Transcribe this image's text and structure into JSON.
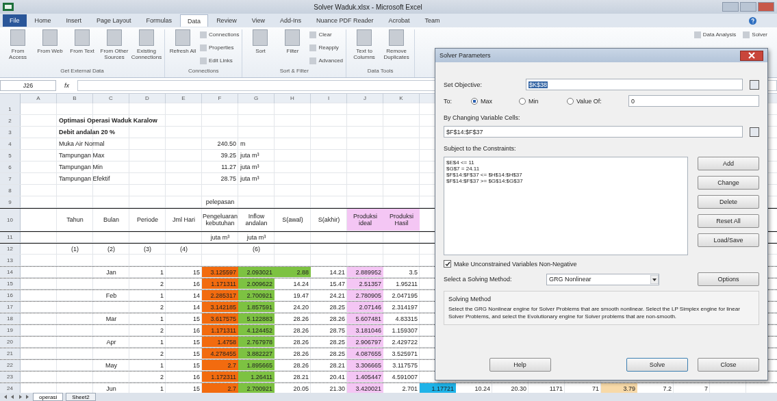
{
  "window": {
    "title": "Solver Waduk.xlsx - Microsoft Excel"
  },
  "tabs": [
    {
      "label": "File",
      "selected": false
    },
    {
      "label": "Home",
      "selected": false
    },
    {
      "label": "Insert",
      "selected": false
    },
    {
      "label": "Page Layout",
      "selected": false
    },
    {
      "label": "Formulas",
      "selected": false
    },
    {
      "label": "Data",
      "selected": true
    },
    {
      "label": "Review",
      "selected": false
    },
    {
      "label": "View",
      "selected": false
    },
    {
      "label": "Add-Ins",
      "selected": false
    },
    {
      "label": "Nuance PDF Reader",
      "selected": false
    },
    {
      "label": "Acrobat",
      "selected": false
    },
    {
      "label": "Team",
      "selected": false
    }
  ],
  "ribbon": {
    "groups": [
      {
        "label": "Get External Data",
        "buttons": [
          {
            "label": "From Access",
            "kind": "large"
          },
          {
            "label": "From Web",
            "kind": "large"
          },
          {
            "label": "From Text",
            "kind": "large"
          },
          {
            "label": "From Other Sources",
            "kind": "large"
          },
          {
            "label": "Existing Connections",
            "kind": "large"
          }
        ]
      },
      {
        "label": "Connections",
        "buttons": [
          {
            "label": "Refresh All",
            "kind": "large"
          },
          {
            "label": "Connections",
            "kind": "small"
          },
          {
            "label": "Properties",
            "kind": "small"
          },
          {
            "label": "Edit Links",
            "kind": "small"
          }
        ]
      },
      {
        "label": "Sort & Filter",
        "buttons": [
          {
            "label": "Sort",
            "kind": "large"
          },
          {
            "label": "Filter",
            "kind": "large"
          },
          {
            "label": "Clear",
            "kind": "small"
          },
          {
            "label": "Reapply",
            "kind": "small"
          },
          {
            "label": "Advanced",
            "kind": "small"
          }
        ]
      },
      {
        "label": "Data Tools",
        "buttons": [
          {
            "label": "Text to Columns",
            "kind": "large"
          },
          {
            "label": "Remove Duplicates",
            "kind": "large"
          }
        ]
      }
    ],
    "right_buttons": [
      "Data Analysis",
      "Solver"
    ]
  },
  "formula_bar": {
    "name_box": "J26",
    "fx": "fx"
  },
  "columns": [
    "A",
    "B",
    "C",
    "D",
    "E",
    "F",
    "G",
    "H",
    "I",
    "J",
    "K"
  ],
  "rows": [
    {
      "num": "1",
      "kind": "blank",
      "cells": {}
    },
    {
      "num": "2",
      "kind": "title",
      "cells": {
        "B": {
          "text": "Optimasi Operasi Waduk Karalow"
        }
      }
    },
    {
      "num": "3",
      "kind": "title",
      "cells": {
        "B": {
          "text": "Debit andalan 20 %"
        }
      }
    },
    {
      "num": "4",
      "kind": "info",
      "cells": {
        "B": {
          "text": "Muka Air Normal"
        },
        "F": {
          "text": "240.50"
        },
        "G": {
          "text": "m"
        }
      }
    },
    {
      "num": "5",
      "kind": "info",
      "cells": {
        "B": {
          "text": "Tampungan Max"
        },
        "F": {
          "text": "39.25"
        },
        "G": {
          "text": "juta m³"
        }
      }
    },
    {
      "num": "6",
      "kind": "info",
      "cells": {
        "B": {
          "text": "Tampungan Min"
        },
        "F": {
          "text": "11.27"
        },
        "G": {
          "text": "juta m³"
        }
      }
    },
    {
      "num": "7",
      "kind": "info",
      "cells": {
        "B": {
          "text": "Tampungan Efektif"
        },
        "F": {
          "text": "28.75"
        },
        "G": {
          "text": "juta m³"
        }
      }
    },
    {
      "num": "8",
      "kind": "blank",
      "cells": {}
    },
    {
      "num": "9",
      "kind": "group",
      "cells": {
        "F": {
          "text": "pelepasan"
        }
      }
    },
    {
      "num": "10",
      "kind": "header",
      "cells": {
        "B": {
          "text": "Tahun"
        },
        "C": {
          "text": "Bulan"
        },
        "D": {
          "text": "Periode"
        },
        "E": {
          "text": "Jml Hari"
        },
        "F": {
          "text": "Pengeluaran kebutuhan"
        },
        "G": {
          "text": "Inflow andalan"
        },
        "H": {
          "text": "S(awal)"
        },
        "I": {
          "text": "S(akhir)"
        },
        "J": {
          "text": "Produksi ideal",
          "color": "#f4c6f4"
        },
        "K": {
          "text": "Produksi Hasil",
          "color": "#f4c6f4"
        }
      }
    },
    {
      "num": "11",
      "kind": "unit",
      "cells": {
        "F": {
          "text": "juta m³"
        },
        "G": {
          "text": "juta m³"
        }
      }
    },
    {
      "num": "12",
      "kind": "index",
      "cells": {
        "B": {
          "text": "(1)"
        },
        "C": {
          "text": "(2)"
        },
        "D": {
          "text": "(3)"
        },
        "E": {
          "text": "(4)"
        },
        "G": {
          "text": "(6)"
        }
      }
    },
    {
      "num": "13",
      "kind": "blank",
      "cells": {}
    },
    {
      "num": "14",
      "kind": "data",
      "cells": {
        "C": {
          "text": "Jan"
        },
        "D": {
          "text": "1"
        },
        "E": {
          "text": "15"
        },
        "F": {
          "text": "3.125597",
          "color": "#f26b0f"
        },
        "G": {
          "text": "2.093021",
          "color": "#7dc242"
        },
        "H": {
          "text": "2.88",
          "color": "#7dc242"
        },
        "I": {
          "text": "14.21"
        },
        "J": {
          "text": "2.889952",
          "color": "#f4c6f4"
        },
        "K": {
          "text": "3.5"
        }
      }
    },
    {
      "num": "15",
      "kind": "data",
      "cells": {
        "D": {
          "text": "2"
        },
        "E": {
          "text": "16"
        },
        "F": {
          "text": "1.171311",
          "color": "#f26b0f"
        },
        "G": {
          "text": "2.009622",
          "color": "#7dc242"
        },
        "H": {
          "text": "14.24"
        },
        "I": {
          "text": "15.47"
        },
        "J": {
          "text": "2.51357",
          "color": "#f4c6f4"
        },
        "K": {
          "text": "1.95211"
        }
      }
    },
    {
      "num": "16",
      "kind": "data",
      "cells": {
        "C": {
          "text": "Feb"
        },
        "D": {
          "text": "1"
        },
        "E": {
          "text": "14"
        },
        "F": {
          "text": "2.285317",
          "color": "#f26b0f"
        },
        "G": {
          "text": "2.700921",
          "color": "#7dc242"
        },
        "H": {
          "text": "19.47"
        },
        "I": {
          "text": "24.21"
        },
        "J": {
          "text": "2.780905",
          "color": "#f4c6f4"
        },
        "K": {
          "text": "2.047195"
        }
      }
    },
    {
      "num": "17",
      "kind": "data",
      "cells": {
        "D": {
          "text": "2"
        },
        "E": {
          "text": "14"
        },
        "F": {
          "text": "3.142185",
          "color": "#f26b0f"
        },
        "G": {
          "text": "1.857591",
          "color": "#7dc242"
        },
        "H": {
          "text": "24.20"
        },
        "I": {
          "text": "28.25"
        },
        "J": {
          "text": "2.07146",
          "color": "#f4c6f4"
        },
        "K": {
          "text": "2.314197"
        }
      }
    },
    {
      "num": "18",
      "kind": "data",
      "cells": {
        "C": {
          "text": "Mar"
        },
        "D": {
          "text": "1"
        },
        "E": {
          "text": "15"
        },
        "F": {
          "text": "3.617575",
          "color": "#f26b0f"
        },
        "G": {
          "text": "5.122883",
          "color": "#7dc242"
        },
        "H": {
          "text": "28.26"
        },
        "I": {
          "text": "28.26"
        },
        "J": {
          "text": "5.607481",
          "color": "#f4c6f4"
        },
        "K": {
          "text": "4.83315"
        }
      }
    },
    {
      "num": "19",
      "kind": "data",
      "cells": {
        "D": {
          "text": "2"
        },
        "E": {
          "text": "16"
        },
        "F": {
          "text": "1.171311",
          "color": "#f26b0f"
        },
        "G": {
          "text": "4.124452",
          "color": "#7dc242"
        },
        "H": {
          "text": "28.26"
        },
        "I": {
          "text": "28.75"
        },
        "J": {
          "text": "3.181046",
          "color": "#f4c6f4"
        },
        "K": {
          "text": "1.159307"
        }
      }
    },
    {
      "num": "20",
      "kind": "data",
      "cells": {
        "C": {
          "text": "Apr"
        },
        "D": {
          "text": "1"
        },
        "E": {
          "text": "15"
        },
        "F": {
          "text": "1.4758",
          "color": "#f26b0f"
        },
        "G": {
          "text": "2.767978",
          "color": "#7dc242"
        },
        "H": {
          "text": "28.26"
        },
        "I": {
          "text": "28.25"
        },
        "J": {
          "text": "2.906797",
          "color": "#f4c6f4"
        },
        "K": {
          "text": "2.429722"
        }
      }
    },
    {
      "num": "21",
      "kind": "data",
      "cells": {
        "D": {
          "text": "2"
        },
        "E": {
          "text": "15"
        },
        "F": {
          "text": "4.278455",
          "color": "#f26b0f"
        },
        "G": {
          "text": "3.882227",
          "color": "#7dc242"
        },
        "H": {
          "text": "28.26"
        },
        "I": {
          "text": "28.25"
        },
        "J": {
          "text": "4.087655",
          "color": "#f4c6f4"
        },
        "K": {
          "text": "3.525971"
        }
      }
    },
    {
      "num": "22",
      "kind": "data",
      "cells": {
        "C": {
          "text": "May"
        },
        "D": {
          "text": "1"
        },
        "E": {
          "text": "15"
        },
        "F": {
          "text": "2.7",
          "color": "#f26b0f"
        },
        "G": {
          "text": "1.895665",
          "color": "#7dc242"
        },
        "H": {
          "text": "28.26"
        },
        "I": {
          "text": "28.21"
        },
        "J": {
          "text": "3.306665",
          "color": "#f4c6f4"
        },
        "K": {
          "text": "3.117575"
        }
      }
    },
    {
      "num": "23",
      "kind": "data",
      "cells": {
        "D": {
          "text": "2"
        },
        "E": {
          "text": "16"
        },
        "F": {
          "text": "1.172311",
          "color": "#f26b0f"
        },
        "G": {
          "text": "1.26411",
          "color": "#7dc242"
        },
        "H": {
          "text": "28.21"
        },
        "I": {
          "text": "20.41"
        },
        "J": {
          "text": "1.405447",
          "color": "#f4c6f4"
        },
        "K": {
          "text": "4.591007"
        }
      }
    },
    {
      "num": "24",
      "kind": "data",
      "cells": {
        "C": {
          "text": "Jun"
        },
        "D": {
          "text": "1"
        },
        "E": {
          "text": "15"
        },
        "F": {
          "text": "2.7",
          "color": "#f26b0f"
        },
        "G": {
          "text": "2.700921",
          "color": "#7dc242"
        },
        "H": {
          "text": "20.05"
        },
        "I": {
          "text": "21.30"
        },
        "J": {
          "text": "3.420021",
          "color": "#f4c6f4"
        },
        "K": {
          "text": "2.701"
        },
        "L": {
          "text": "1.17721",
          "color": "#1fb3e8"
        },
        "M": {
          "text": "10.24"
        },
        "N": {
          "text": "20.30"
        },
        "O": {
          "text": "1171"
        },
        "P": {
          "text": "71"
        },
        "Q": {
          "text": "3.79",
          "color": "#f7d9a8"
        },
        "R": {
          "text": "7.2"
        },
        "S": {
          "text": "7"
        }
      }
    }
  ],
  "sheet_tabs": [
    {
      "label": "operasi",
      "selected": true
    },
    {
      "label": "Sheet2",
      "selected": false
    }
  ],
  "dialog": {
    "title": "Solver Parameters",
    "objective": {
      "label": "Set Objective:",
      "value": "$K$38"
    },
    "to": {
      "label": "To:",
      "options": [
        {
          "label": "Max",
          "selected": true
        },
        {
          "label": "Min",
          "selected": false
        },
        {
          "label": "Value Of:",
          "selected": false
        }
      ],
      "value": "0"
    },
    "variables": {
      "label": "By Changing Variable Cells:",
      "value": "$F$14:$F$37"
    },
    "constraints": {
      "label": "Subject to the Constraints:",
      "items": [
        "$E$4 <= 11",
        "$G$7 = 24.11",
        "$F$14:$F$37 <= $H$14:$H$37",
        "$F$14:$F$37 >= $G$14:$G$37"
      ]
    },
    "side_buttons": [
      "Add",
      "Change",
      "Delete",
      "Reset All",
      "Load/Save"
    ],
    "nonneg": {
      "label": "Make Unconstrained Variables Non-Negative",
      "checked": true
    },
    "method": {
      "label": "Select a Solving Method:",
      "value": "GRG Nonlinear",
      "options_button": "Options"
    },
    "solving": {
      "title": "Solving Method",
      "text": "Select the GRG Nonlinear engine for Solver Problems that are smooth nonlinear. Select the LP Simplex engine for linear Solver Problems, and select the Evolutionary engine for Solver problems that are non-smooth."
    },
    "buttons": [
      {
        "label": "Help",
        "kind": "help"
      },
      {
        "label": "Solve",
        "kind": "default"
      },
      {
        "label": "Close",
        "kind": "normal"
      }
    ]
  }
}
